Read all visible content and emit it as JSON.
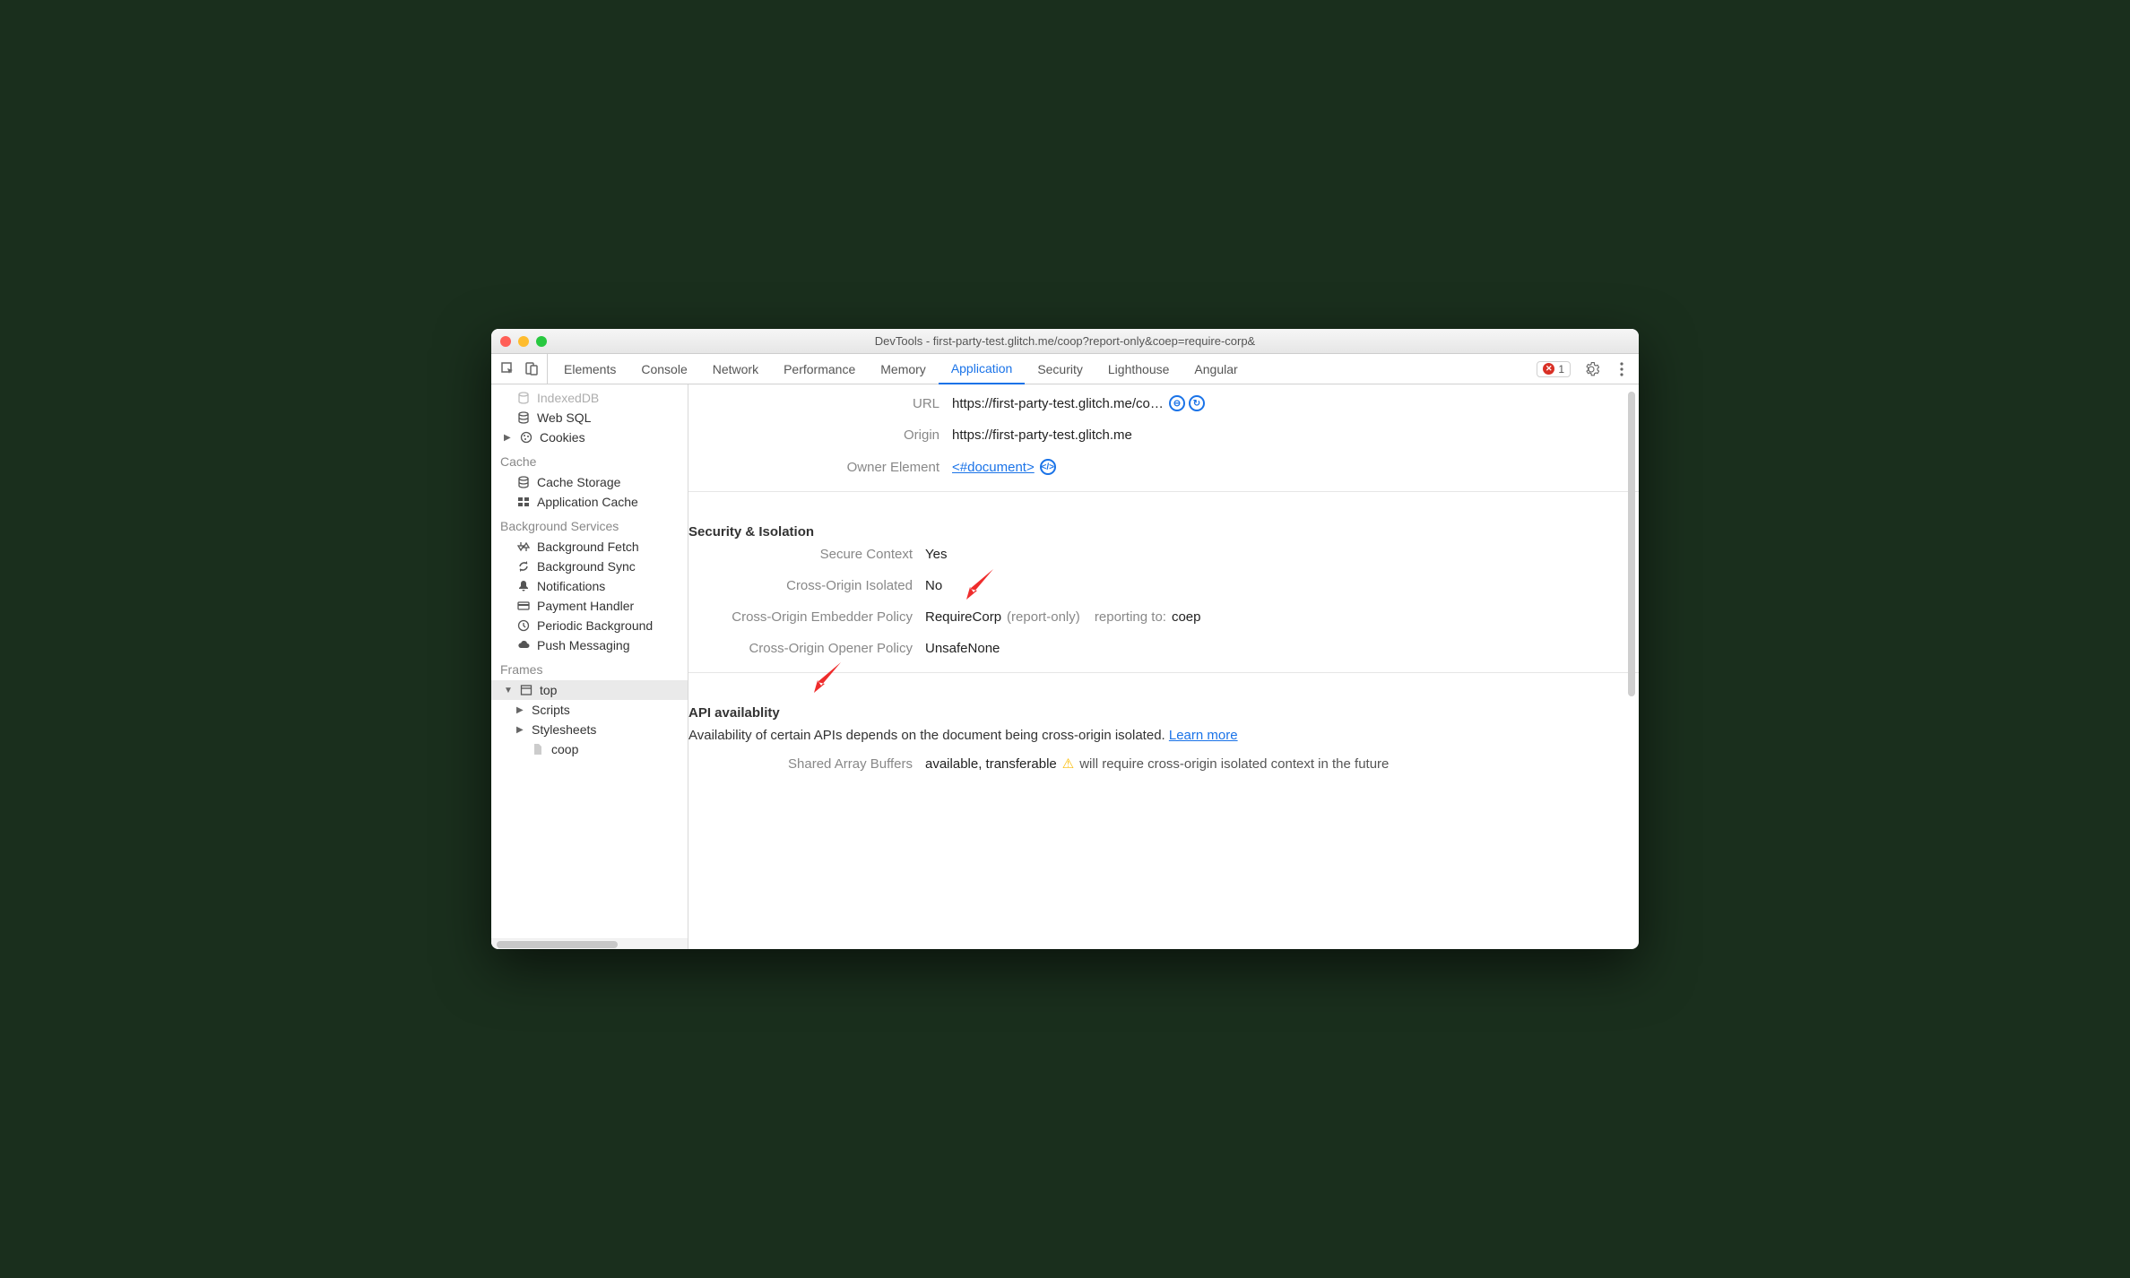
{
  "window": {
    "title": "DevTools - first-party-test.glitch.me/coop?report-only&coep=require-corp&"
  },
  "tabs": {
    "items": [
      "Elements",
      "Console",
      "Network",
      "Performance",
      "Memory",
      "Application",
      "Security",
      "Lighthouse",
      "Angular"
    ],
    "activeIndex": 5
  },
  "errorBadge": {
    "count": "1"
  },
  "sidebar": {
    "storage": [
      {
        "label": "IndexedDB"
      },
      {
        "label": "Web SQL"
      },
      {
        "label": "Cookies",
        "expandable": true
      }
    ],
    "cache_header": "Cache",
    "cache": [
      {
        "label": "Cache Storage"
      },
      {
        "label": "Application Cache"
      }
    ],
    "bg_header": "Background Services",
    "bg": [
      {
        "label": "Background Fetch"
      },
      {
        "label": "Background Sync"
      },
      {
        "label": "Notifications"
      },
      {
        "label": "Payment Handler"
      },
      {
        "label": "Periodic Background"
      },
      {
        "label": "Push Messaging"
      }
    ],
    "frames_header": "Frames",
    "frames_top": "top",
    "frames_children": [
      "Scripts",
      "Stylesheets"
    ],
    "frames_leaf": "coop"
  },
  "content": {
    "url_label": "URL",
    "url_value": "https://first-party-test.glitch.me/co…",
    "origin_label": "Origin",
    "origin_value": "https://first-party-test.glitch.me",
    "owner_label": "Owner Element",
    "owner_value": "<#document>",
    "sec_header": "Security & Isolation",
    "secure_context_label": "Secure Context",
    "secure_context_value": "Yes",
    "coi_label": "Cross-Origin Isolated",
    "coi_value": "No",
    "coep_label": "Cross-Origin Embedder Policy",
    "coep_value": "RequireCorp",
    "coep_report_mode": "(report-only)",
    "coep_reporting_label": "reporting to:",
    "coep_reporting_value": "coep",
    "coop_label": "Cross-Origin Opener Policy",
    "coop_value": "UnsafeNone",
    "api_header": "API availablity",
    "api_desc": "Availability of certain APIs depends on the document being cross-origin isolated. ",
    "api_learn": "Learn more",
    "sab_label": "Shared Array Buffers",
    "sab_value": "available, transferable",
    "sab_warn_text": "will require cross-origin isolated context in the future"
  }
}
